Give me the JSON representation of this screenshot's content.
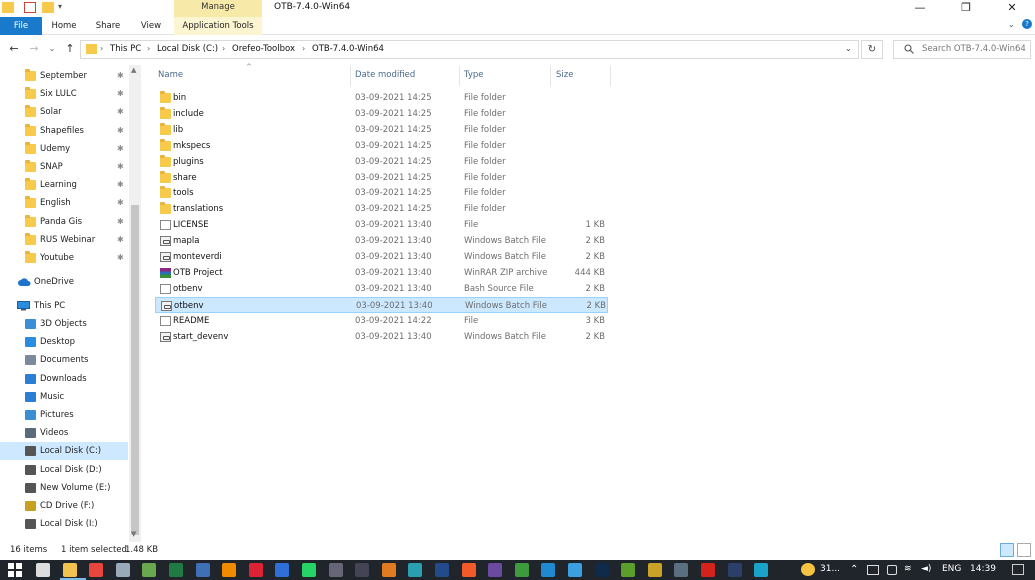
{
  "window": {
    "title": "OTB-7.4.0-Win64",
    "contextual_tab_group": "Manage",
    "controls": {
      "minimize": "—",
      "maximize": "❐",
      "close": "✕"
    }
  },
  "ribbon": {
    "tabs": [
      {
        "label": "File"
      },
      {
        "label": "Home"
      },
      {
        "label": "Share"
      },
      {
        "label": "View"
      },
      {
        "label": "Application Tools"
      }
    ]
  },
  "address": {
    "breadcrumb": [
      "This PC",
      "Local Disk (C:)",
      "Orefeo-Toolbox",
      "OTB-7.4.0-Win64"
    ],
    "search_placeholder": "Search OTB-7.4.0-Win64"
  },
  "sidebar": {
    "quick_access": [
      {
        "label": "September",
        "icon": "folder-icon",
        "pinned": true
      },
      {
        "label": "Six LULC",
        "icon": "folder-icon",
        "pinned": true
      },
      {
        "label": "Solar",
        "icon": "folder-icon",
        "pinned": true
      },
      {
        "label": "Shapefiles",
        "icon": "folder-icon",
        "pinned": true
      },
      {
        "label": "Udemy",
        "icon": "folder-icon",
        "pinned": true
      },
      {
        "label": "SNAP",
        "icon": "folder-icon",
        "pinned": true
      },
      {
        "label": "Learning",
        "icon": "folder-icon",
        "pinned": true
      },
      {
        "label": "English",
        "icon": "folder-icon",
        "pinned": true
      },
      {
        "label": "Panda Gis",
        "icon": "folder-icon",
        "pinned": true
      },
      {
        "label": "RUS Webinar",
        "icon": "folder-icon",
        "pinned": true
      },
      {
        "label": "Youtube",
        "icon": "folder-icon",
        "pinned": true
      }
    ],
    "onedrive": {
      "label": "OneDrive",
      "icon": "cloud-icon"
    },
    "this_pc": {
      "label": "This PC",
      "icon": "computer-icon"
    },
    "pc_items": [
      {
        "label": "3D Objects",
        "icon": "cube-icon",
        "color": "#3b8fd6"
      },
      {
        "label": "Desktop",
        "icon": "desktop-icon",
        "color": "#2a8de0"
      },
      {
        "label": "Documents",
        "icon": "document-icon",
        "color": "#7a8a9a"
      },
      {
        "label": "Downloads",
        "icon": "download-arrow-icon",
        "color": "#2a7fd4"
      },
      {
        "label": "Music",
        "icon": "music-note-icon",
        "color": "#2a7fd4"
      },
      {
        "label": "Pictures",
        "icon": "picture-icon",
        "color": "#3a8fd4"
      },
      {
        "label": "Videos",
        "icon": "film-icon",
        "color": "#5a6a7a"
      },
      {
        "label": "Local Disk (C:)",
        "icon": "drive-icon",
        "color": "#555",
        "selected": true
      },
      {
        "label": "Local Disk (D:)",
        "icon": "drive-icon",
        "color": "#555"
      },
      {
        "label": "New Volume (E:)",
        "icon": "drive-icon",
        "color": "#555"
      },
      {
        "label": "CD Drive (F:)",
        "icon": "cd-icon",
        "color": "#c8a020"
      },
      {
        "label": "Local Disk (I:)",
        "icon": "drive-icon",
        "color": "#555"
      }
    ]
  },
  "columns": {
    "name": "Name",
    "date": "Date modified",
    "type": "Type",
    "size": "Size"
  },
  "files": [
    {
      "name": "bin",
      "date": "03-09-2021 14:25",
      "type": "File folder",
      "size": "",
      "icon": "folder"
    },
    {
      "name": "include",
      "date": "03-09-2021 14:25",
      "type": "File folder",
      "size": "",
      "icon": "folder"
    },
    {
      "name": "lib",
      "date": "03-09-2021 14:25",
      "type": "File folder",
      "size": "",
      "icon": "folder"
    },
    {
      "name": "mkspecs",
      "date": "03-09-2021 14:25",
      "type": "File folder",
      "size": "",
      "icon": "folder"
    },
    {
      "name": "plugins",
      "date": "03-09-2021 14:25",
      "type": "File folder",
      "size": "",
      "icon": "folder"
    },
    {
      "name": "share",
      "date": "03-09-2021 14:25",
      "type": "File folder",
      "size": "",
      "icon": "folder"
    },
    {
      "name": "tools",
      "date": "03-09-2021 14:25",
      "type": "File folder",
      "size": "",
      "icon": "folder"
    },
    {
      "name": "translations",
      "date": "03-09-2021 14:25",
      "type": "File folder",
      "size": "",
      "icon": "folder"
    },
    {
      "name": "LICENSE",
      "date": "03-09-2021 13:40",
      "type": "File",
      "size": "1 KB",
      "icon": "file"
    },
    {
      "name": "mapla",
      "date": "03-09-2021 13:40",
      "type": "Windows Batch File",
      "size": "2 KB",
      "icon": "batch"
    },
    {
      "name": "monteverdi",
      "date": "03-09-2021 13:40",
      "type": "Windows Batch File",
      "size": "2 KB",
      "icon": "batch"
    },
    {
      "name": "OTB Project",
      "date": "03-09-2021 13:40",
      "type": "WinRAR ZIP archive",
      "size": "444 KB",
      "icon": "rar"
    },
    {
      "name": "otbenv",
      "date": "03-09-2021 13:40",
      "type": "Bash Source File",
      "size": "2 KB",
      "icon": "file"
    },
    {
      "name": "otbenv",
      "date": "03-09-2021 13:40",
      "type": "Windows Batch File",
      "size": "2 KB",
      "icon": "batch",
      "selected": true
    },
    {
      "name": "README",
      "date": "03-09-2021 14:22",
      "type": "File",
      "size": "3 KB",
      "icon": "file"
    },
    {
      "name": "start_devenv",
      "date": "03-09-2021 13:40",
      "type": "Windows Batch File",
      "size": "2 KB",
      "icon": "batch"
    }
  ],
  "status": {
    "items": "16 items",
    "selected": "1 item selected",
    "size": "1.48 KB"
  },
  "taskbar": {
    "apps": [
      {
        "name": "task-view-icon",
        "color": "#dddddd"
      },
      {
        "name": "file-explorer-icon",
        "color": "#f2c14e"
      },
      {
        "name": "chrome-icon",
        "color": "#e8453c"
      },
      {
        "name": "search-app-icon",
        "color": "#9ab"
      },
      {
        "name": "qgis-icon",
        "color": "#6aa84f"
      },
      {
        "name": "excel-icon",
        "color": "#1f7a44"
      },
      {
        "name": "app-w-icon",
        "color": "#3f6fb5"
      },
      {
        "name": "vlc-icon",
        "color": "#f08a00"
      },
      {
        "name": "app-red-icon",
        "color": "#d23"
      },
      {
        "name": "app-blue-icon",
        "color": "#2f6fd8"
      },
      {
        "name": "whatsapp-icon",
        "color": "#25d366"
      },
      {
        "name": "app-gray-icon",
        "color": "#667"
      },
      {
        "name": "app-dark-icon",
        "color": "#445"
      },
      {
        "name": "app-orange-icon",
        "color": "#e07b21"
      },
      {
        "name": "app-teal-icon",
        "color": "#2a9fb0"
      },
      {
        "name": "app-darkblue-icon",
        "color": "#234a8a"
      },
      {
        "name": "brave-icon",
        "color": "#f25a2a"
      },
      {
        "name": "app-purple-icon",
        "color": "#6b4aa0"
      },
      {
        "name": "app-green-icon",
        "color": "#3d9a3d"
      },
      {
        "name": "vscode-icon",
        "color": "#1f8ad2"
      },
      {
        "name": "app-sky-icon",
        "color": "#3aa0e0"
      },
      {
        "name": "photoshop-icon",
        "color": "#0f2a4a"
      },
      {
        "name": "app-lime-icon",
        "color": "#5aa02a"
      },
      {
        "name": "app-gold-icon",
        "color": "#c9a227"
      },
      {
        "name": "app-steel-icon",
        "color": "#5a6f80"
      },
      {
        "name": "acrobat-icon",
        "color": "#d4231c"
      },
      {
        "name": "app-navy-icon",
        "color": "#2b3f6a"
      },
      {
        "name": "app-cyan-icon",
        "color": "#1aa3c8"
      }
    ],
    "weather": "31...",
    "language": "ENG",
    "time": "14:39"
  }
}
